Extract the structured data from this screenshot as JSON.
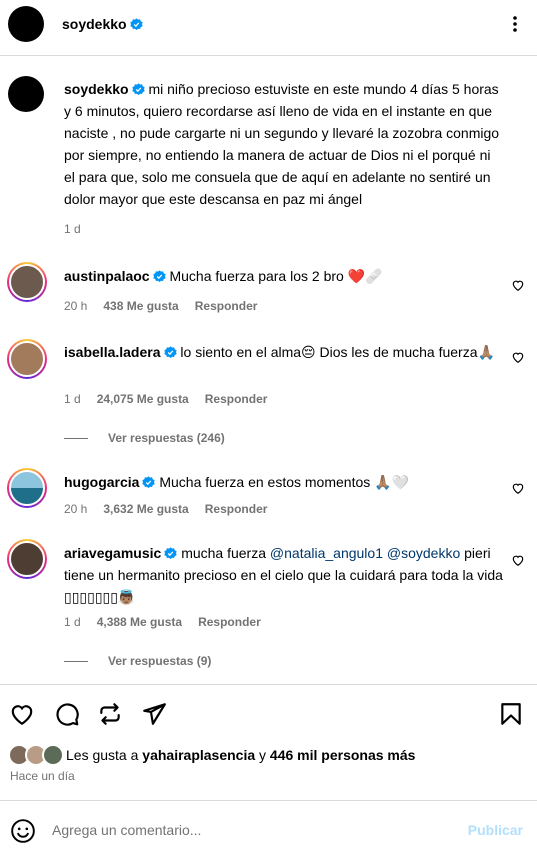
{
  "post": {
    "username": "soydekko",
    "caption": "mi niño precioso estuviste en este mundo 4 días 5 horas y 6 minutos, quiero recordarse así lleno de vida en el instante en que naciste , no pude cargarte ni un segundo y llevaré la zozobra conmigo por siempre, no entiendo la manera de actuar de Dios ni el porqué ni el para que, solo me consuela que de aquí en adelante no sentiré un dolor mayor que este descansa en paz mi ángel",
    "caption_time": "1 d"
  },
  "comments": [
    {
      "username": "austinpalaoc",
      "text": "Mucha fuerza para los 2 bro ❤️🩹",
      "time": "20 h",
      "likes": "438 Me gusta",
      "reply": "Responder"
    },
    {
      "username": "isabella.ladera",
      "text": "lo siento en el alma😔 Dios les de mucha fuerza🙏🏽",
      "time": "1 d",
      "likes": "24,075 Me gusta",
      "reply": "Responder",
      "replies": "Ver respuestas (246)"
    },
    {
      "username": "hugogarcia",
      "text": "Mucha fuerza en estos momentos 🙏🏽🤍",
      "time": "20 h",
      "likes": "3,632 Me gusta",
      "reply": "Responder"
    },
    {
      "username": "ariavegamusic",
      "text_before": "mucha fuerza ",
      "mention1": "@natalia_angulo1",
      "mention2": "@soydekko",
      "text_after": "pieri tiene un hermanito precioso en el cielo que la cuidará para toda la vida ▯▯▯▯▯▯▯👼🏽",
      "time": "1 d",
      "likes": "4,388 Me gusta",
      "reply": "Responder",
      "replies": "Ver respuestas (9)"
    }
  ],
  "likes_line": {
    "prefix": "Les gusta a ",
    "user": "yahairaplasencia",
    "middle": " y ",
    "count": "446 mil personas más"
  },
  "time_ago": "Hace un día",
  "add_comment": {
    "placeholder": "Agrega un comentario...",
    "post_label": "Publicar"
  },
  "colors": {
    "verified": "#0095f6",
    "muted": "#737373",
    "link": "#00376b",
    "post_disabled": "#b2dffc"
  },
  "icons": [
    "more-icon",
    "heart-icon",
    "comment-icon",
    "repost-icon",
    "share-icon",
    "save-icon",
    "emoji-icon",
    "verified-icon"
  ]
}
